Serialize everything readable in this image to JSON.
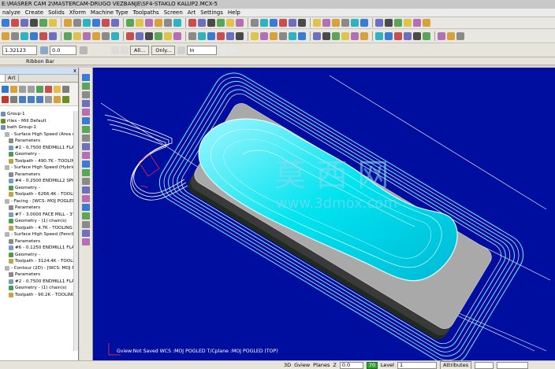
{
  "window": {
    "title": "E:\\MASRER CAM 2\\MASTERCAM-DRUGO VEZBANJE\\SF4-STAKLO KALUP2.MCX-5"
  },
  "menu": {
    "items": [
      "nalyze",
      "Create",
      "Solids",
      "Xform",
      "Machine Type",
      "Toolpaths",
      "Screen",
      "Art",
      "Settings",
      "Help"
    ]
  },
  "ribbon": {
    "field1": "1.32123",
    "field2": "0.0",
    "all_button": "All...",
    "only_button": "Only...",
    "in_select": "In",
    "label": "Ribbon Bar"
  },
  "panel": {
    "tab_art": "Art",
    "close_glyph": "x",
    "selected_item_label": "Toolpath - 90.2K - TOOLING SPLIT2\\"
  },
  "tree": [
    {
      "text": "Group-1",
      "indent": 0,
      "icon": "folder-icon",
      "color": "#6f8fb8"
    },
    {
      "text": "rties - Mill Default",
      "indent": 0,
      "icon": "properties-icon",
      "color": "#6b8e23"
    },
    {
      "text": "bath Group-1",
      "indent": 0,
      "icon": "group-icon",
      "color": "#6f8fb8"
    },
    {
      "text": "- Surface High Speed (Area clearance)",
      "indent": 1,
      "icon": "operation-icon",
      "color": "#b4b4b4"
    },
    {
      "text": "Parameters",
      "indent": 2,
      "icon": "parameters-icon",
      "color": "#8a8a8a"
    },
    {
      "text": "#2 - 0.7500 ENDMILL1 FLAT - 3/4 F",
      "indent": 2,
      "icon": "tool-icon",
      "color": "#7a9cc6"
    },
    {
      "text": "Geometry -",
      "indent": 2,
      "icon": "geometry-icon",
      "color": "#4a9e4a"
    },
    {
      "text": "Toolpath - 490.7K - TOOLING SPLIT2",
      "indent": 2,
      "icon": "toolpath-icon",
      "color": "#c2a24a"
    },
    {
      "text": "- Surface High Speed (Hybrid) - [WCS:",
      "indent": 1,
      "icon": "operation-icon",
      "color": "#b4b4b4"
    },
    {
      "text": "Parameters",
      "indent": 2,
      "icon": "parameters-icon",
      "color": "#8a8a8a"
    },
    {
      "text": "#4 - 0.2500 ENDMILL2 SPHERE - 1/",
      "indent": 2,
      "icon": "tool-icon",
      "color": "#7a9cc6"
    },
    {
      "text": "Geometry -",
      "indent": 2,
      "icon": "geometry-icon",
      "color": "#4a9e4a"
    },
    {
      "text": "Toolpath - 6266.4K - TOOLING SPLI",
      "indent": 2,
      "icon": "toolpath-icon",
      "color": "#c2a24a"
    },
    {
      "text": "- Facing - [WCS: MOJ POGLED] - [Tpla",
      "indent": 1,
      "icon": "operation-icon",
      "color": "#b4b4b4"
    },
    {
      "text": "Parameters",
      "indent": 2,
      "icon": "parameters-icon",
      "color": "#8a8a8a"
    },
    {
      "text": "#7 - 3.0000 FACE MILL - 3\" FACE MI",
      "indent": 2,
      "icon": "tool-icon",
      "color": "#7a9cc6"
    },
    {
      "text": "Geometry - (1) chain(s)",
      "indent": 2,
      "icon": "geometry-icon",
      "color": "#4a9e4a"
    },
    {
      "text": "Toolpath - 4.7K - TOOLING SPLIT29",
      "indent": 2,
      "icon": "toolpath-icon",
      "color": "#c2a24a"
    },
    {
      "text": "- Surface High Speed (Pencil rest passe",
      "indent": 1,
      "icon": "operation-icon",
      "color": "#b4b4b4"
    },
    {
      "text": "Parameters",
      "indent": 2,
      "icon": "parameters-icon",
      "color": "#8a8a8a"
    },
    {
      "text": "#6 - 0.1250 ENDMILL1 FLAT - 1/8 F",
      "indent": 2,
      "icon": "tool-icon",
      "color": "#7a9cc6"
    },
    {
      "text": "Geometry -",
      "indent": 2,
      "icon": "geometry-icon",
      "color": "#4a9e4a"
    },
    {
      "text": "Toolpath - 3124.4K - TOOLING SPLI",
      "indent": 2,
      "icon": "toolpath-icon",
      "color": "#c2a24a"
    },
    {
      "text": "- Contour (2D) - [WCS: MOJ POGLED]",
      "indent": 1,
      "icon": "operation-icon",
      "color": "#b4b4b4"
    },
    {
      "text": "Parameters",
      "indent": 2,
      "icon": "parameters-icon",
      "color": "#8a8a8a"
    },
    {
      "text": "#2 - 0.7500 ENDMILL1 FLAT - 3/4 F",
      "indent": 2,
      "icon": "tool-icon",
      "color": "#7a9cc6"
    },
    {
      "text": "Geometry - (1) chain(s)",
      "indent": 2,
      "icon": "geometry-icon",
      "color": "#4a9e4a"
    },
    {
      "text": "Toolpath - 90.2K - TOOLING SPLIT2\\",
      "indent": 2,
      "icon": "toolpath-icon",
      "color": "#c2a24a"
    }
  ],
  "viewport": {
    "status_text": "Gview:Not Saved  WCS :MOJ POGLED  T/Cplane :MOJ POGLED (TOP)",
    "background": "#000ea0",
    "watermark_cn": "莫 西 网",
    "watermark_url": "www.3dmox.com"
  },
  "statusbar": {
    "mode_3d": "3D",
    "gview": "Gview",
    "planes": "Planes",
    "z_label": "Z",
    "z_value": "0.0",
    "green_value": "70",
    "level_label": "Level",
    "level_value": "1",
    "attributes": "Attributes"
  },
  "colors": {
    "toolpath_cyan": "#00e5f0",
    "part_gray": "#a9a9a9",
    "selection_blue": "#33a3f0"
  }
}
